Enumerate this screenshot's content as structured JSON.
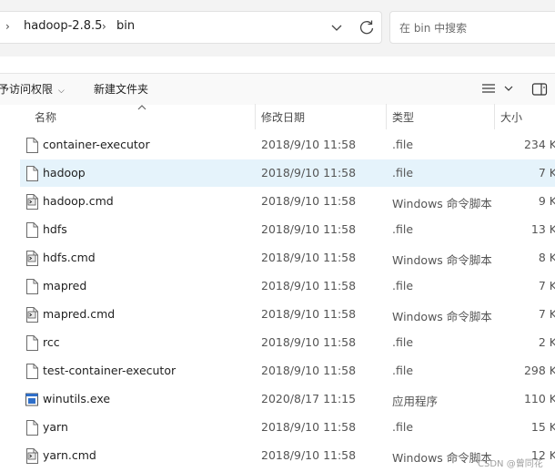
{
  "address": {
    "crumb1": "hadoop-2.8.5",
    "crumb2": "bin"
  },
  "search": {
    "placeholder": "在 bin 中搜索"
  },
  "toolbar": {
    "access_label": "予访问权限",
    "new_folder_label": "新建文件夹"
  },
  "columns": {
    "name": "名称",
    "date": "修改日期",
    "type": "类型",
    "size": "大小"
  },
  "files": [
    {
      "name": "container-executor",
      "date": "2018/9/10 11:58",
      "type": ".file",
      "size": "234 K",
      "icon": "file-icon"
    },
    {
      "name": "hadoop",
      "date": "2018/9/10 11:58",
      "type": ".file",
      "size": "7 K",
      "icon": "file-icon",
      "selected": true
    },
    {
      "name": "hadoop.cmd",
      "date": "2018/9/10 11:58",
      "type": "Windows 命令脚本",
      "size": "9 K",
      "icon": "cmd-script-icon"
    },
    {
      "name": "hdfs",
      "date": "2018/9/10 11:58",
      "type": ".file",
      "size": "13 K",
      "icon": "file-icon"
    },
    {
      "name": "hdfs.cmd",
      "date": "2018/9/10 11:58",
      "type": "Windows 命令脚本",
      "size": "8 K",
      "icon": "cmd-script-icon"
    },
    {
      "name": "mapred",
      "date": "2018/9/10 11:58",
      "type": ".file",
      "size": "7 K",
      "icon": "file-icon"
    },
    {
      "name": "mapred.cmd",
      "date": "2018/9/10 11:58",
      "type": "Windows 命令脚本",
      "size": "7 K",
      "icon": "cmd-script-icon"
    },
    {
      "name": "rcc",
      "date": "2018/9/10 11:58",
      "type": ".file",
      "size": "2 K",
      "icon": "file-icon"
    },
    {
      "name": "test-container-executor",
      "date": "2018/9/10 11:58",
      "type": ".file",
      "size": "298 K",
      "icon": "file-icon"
    },
    {
      "name": "winutils.exe",
      "date": "2020/8/17 11:15",
      "type": "应用程序",
      "size": "110 K",
      "icon": "exe-icon"
    },
    {
      "name": "yarn",
      "date": "2018/9/10 11:58",
      "type": ".file",
      "size": "15 K",
      "icon": "file-icon"
    },
    {
      "name": "yarn.cmd",
      "date": "2018/9/10 11:58",
      "type": "Windows 命令脚本",
      "size": "12 K",
      "icon": "cmd-script-icon"
    }
  ],
  "watermark": "CSDN @曾同花",
  "colors": {
    "selection": "#e5f3fb",
    "toolbar_bg": "#f3f3f3"
  }
}
